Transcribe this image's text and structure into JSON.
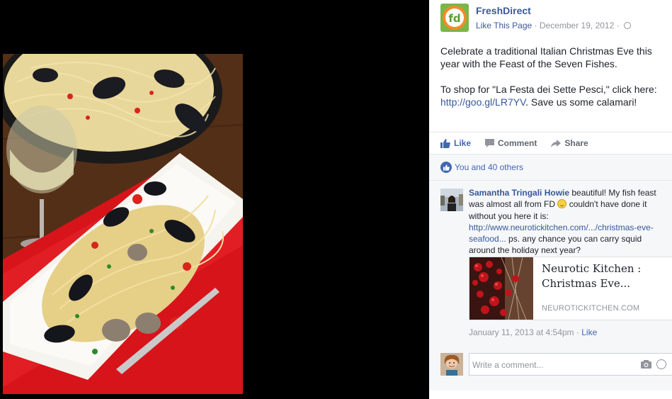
{
  "page": {
    "name": "FreshDirect",
    "avatar_text": "fd",
    "like_page": "Like This Page",
    "separator": "·",
    "date": "December 19, 2012",
    "audience_icon": "globe-icon"
  },
  "post": {
    "paragraph1": "Celebrate a traditional Italian Christmas Eve this year with the Feast of the Seven Fishes.",
    "paragraph2_before": "To shop for \"La Festa dei Sette Pesci,\" click here: ",
    "paragraph2_link": "http://goo.gl/LR7YV",
    "paragraph2_after": ". Save us some calamari!"
  },
  "actions": {
    "like": "Like",
    "comment": "Comment",
    "share": "Share"
  },
  "likes": {
    "summary": "You and 40 others"
  },
  "comment": {
    "author": "Samantha Tringali Howie",
    "text_part1": " beautiful! My fish feast was almost all from FD ",
    "text_part2": " couldn't have done it without you here it is: ",
    "link": "http://www.neurotickitchen.com/.../christmas-eve-seafood...",
    "text_part3": " ps. any chance you can carry squid around the holiday next year?",
    "emoji": "smile-emoji",
    "link_card": {
      "title": "Neurotic Kitchen : Christmas Eve...",
      "domain": "NEUROTICKITCHEN.COM"
    },
    "timestamp": "January 11, 2013 at 4:54pm",
    "separator": "·",
    "like": "Like"
  },
  "composer": {
    "placeholder": "Write a comment..."
  },
  "colors": {
    "link": "#365899",
    "like_blue": "#4267b2",
    "meta_gray": "#90949c",
    "feedback_bg": "#f6f7f9",
    "background": "#000000"
  }
}
